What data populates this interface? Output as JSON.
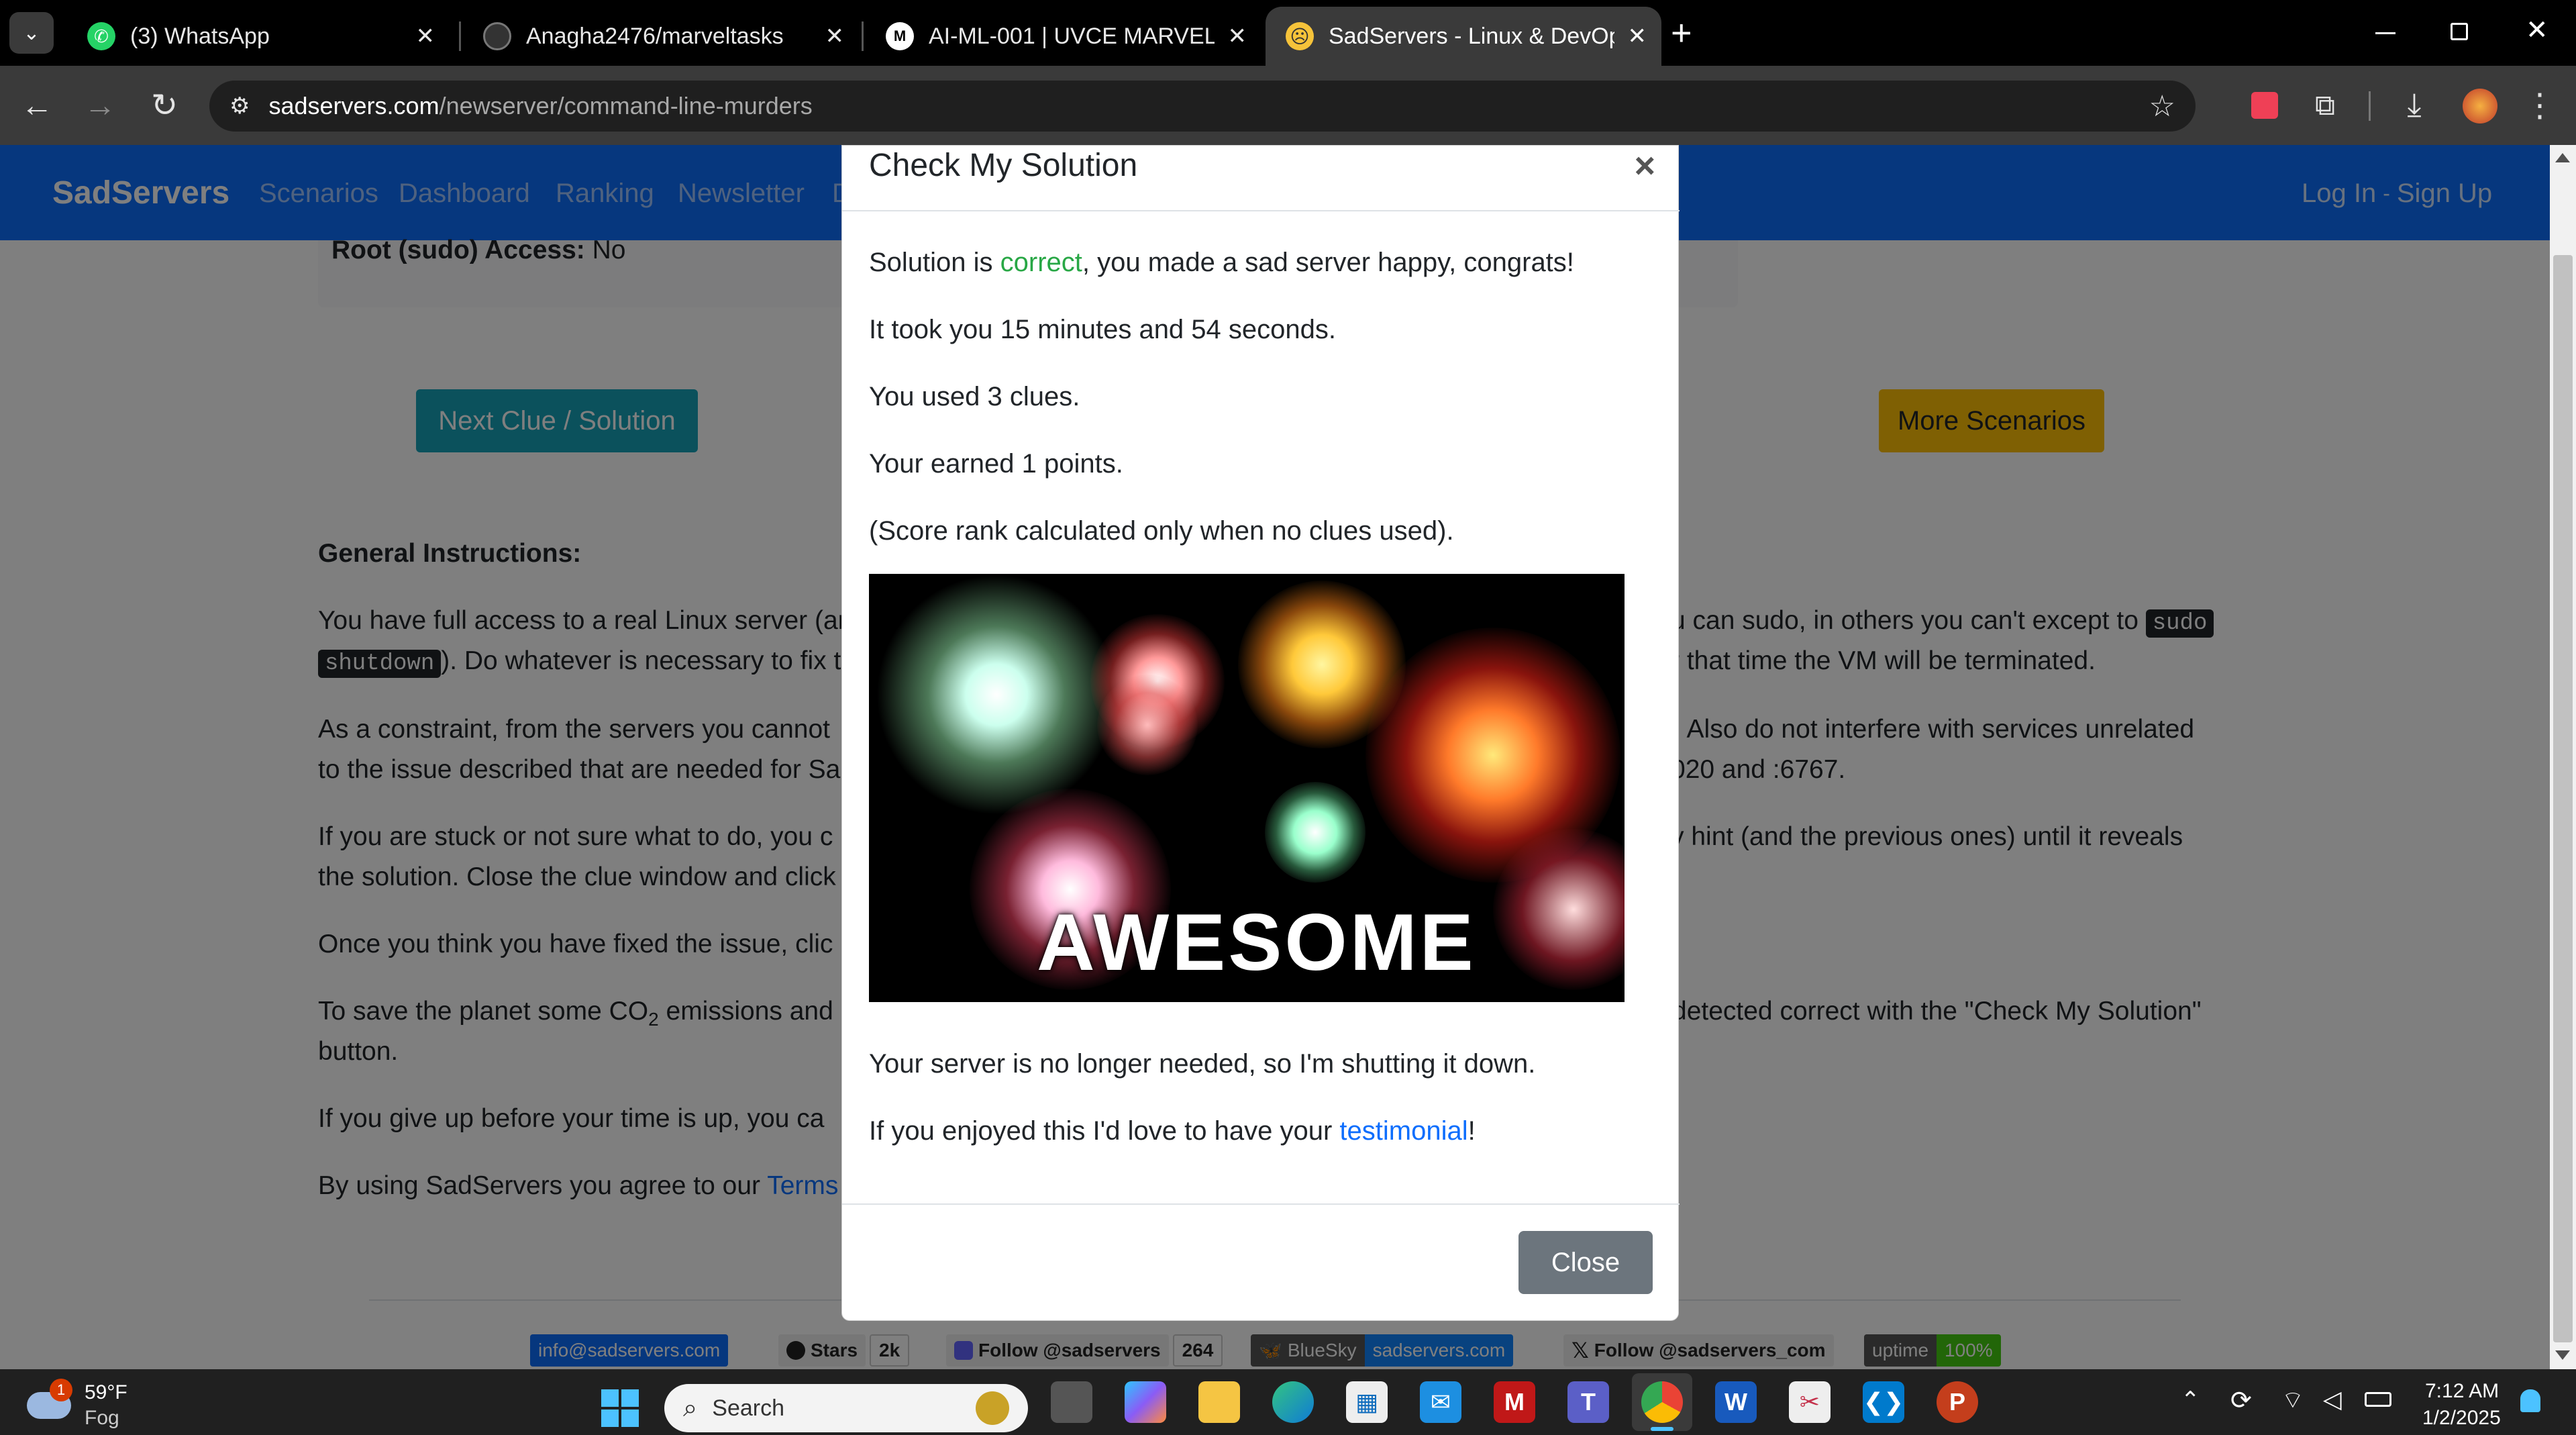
{
  "browser": {
    "tabs": [
      {
        "label": "(3) WhatsApp",
        "icon": "whatsapp-icon"
      },
      {
        "label": "Anagha2476/marveltasks",
        "icon": "github-icon"
      },
      {
        "label": "AI-ML-001 | UVCE MARVEL",
        "icon": "marvel-icon"
      },
      {
        "label": "SadServers - Linux & DevOps Tr",
        "icon": "sadservers-icon"
      }
    ],
    "close_glyph": "✕",
    "new_tab_glyph": "+",
    "url_host": "sadservers.com",
    "url_path": "/newserver/command-line-murders"
  },
  "navbar": {
    "brand": "SadServers",
    "links": [
      "Scenarios",
      "Dashboard",
      "Ranking",
      "Newsletter",
      "D"
    ],
    "login": "Log In",
    "separator": "-",
    "signup": "Sign Up"
  },
  "page": {
    "root_label": "Root (sudo) Access:",
    "root_value": "No",
    "next_clue_button": "Next Clue / Solution",
    "more_scenarios_button": "More Scenarios",
    "instructions_heading": "General Instructions:",
    "p1a": "You have full access to a real Linux server (ar",
    "p1b": "u can sudo, in others you can't except to",
    "p1_code1": "sudo",
    "p1_code2": "shutdown",
    "p1c": "). Do whatever is necessary to fix th",
    "p1d": "r that time the VM will be terminated.",
    "p2a": "As a constraint, from the servers you cannot",
    "p2b": ". Also do not interfere with services unrelated",
    "p2c": "to the issue described that are needed for Sa",
    "p2d": "020 and :6767.",
    "p3a": "If you are stuck or not sure what to do, you c",
    "p3b": "y hint (and the previous ones) until it reveals",
    "p3c": "the solution. Close the clue window and click",
    "p4a": "Once you think you have fixed the issue, clic",
    "p5a": "To save the planet some CO",
    "p5_sub": "2",
    "p5b": " emissions and a",
    "p5c": "detected correct with the \"Check My Solution\"",
    "p5d": "button.",
    "p6a": "If you give up before your time is up, you ca",
    "p7a": "By using SadServers you agree to our",
    "p7_link": "Terms"
  },
  "footer_badges": {
    "email": "info@sadservers.com",
    "stars_label": "Stars",
    "stars_count": "2k",
    "mastodon_label": "Follow @sadservers",
    "mastodon_count": "264",
    "bluesky_label": "BlueSky",
    "bluesky_value": "sadservers.com",
    "x_label": "Follow @sadservers_com",
    "uptime_label": "uptime",
    "uptime_value": "100%"
  },
  "modal": {
    "title": "Check My Solution",
    "close_x": "×",
    "line1_pre": "Solution is ",
    "line1_status": "correct",
    "line1_post": ", you made a sad server happy, congrats!",
    "line2": "It took you 15 minutes and 54 seconds.",
    "line3": "You used 3 clues.",
    "line4": "Your earned 1 points.",
    "line5": "(Score rank calculated only when no clues used).",
    "image_text": "AWESOME",
    "line6": "Your server is no longer needed, so I'm shutting it down.",
    "line7_pre": "If you enjoyed this I'd love to have your ",
    "line7_link": "testimonial",
    "line7_post": "!",
    "close_button": "Close"
  },
  "taskbar": {
    "weather_temp": "59°F",
    "weather_desc": "Fog",
    "weather_badge": "1",
    "search_placeholder": "Search",
    "time": "7:12 AM",
    "date": "1/2/2025"
  },
  "colors": {
    "navbar": "#0d6efd",
    "success": "#28a745",
    "info_button": "#17a2b8",
    "warning_button": "#ffc107",
    "modal_close_button": "#6c757d"
  }
}
